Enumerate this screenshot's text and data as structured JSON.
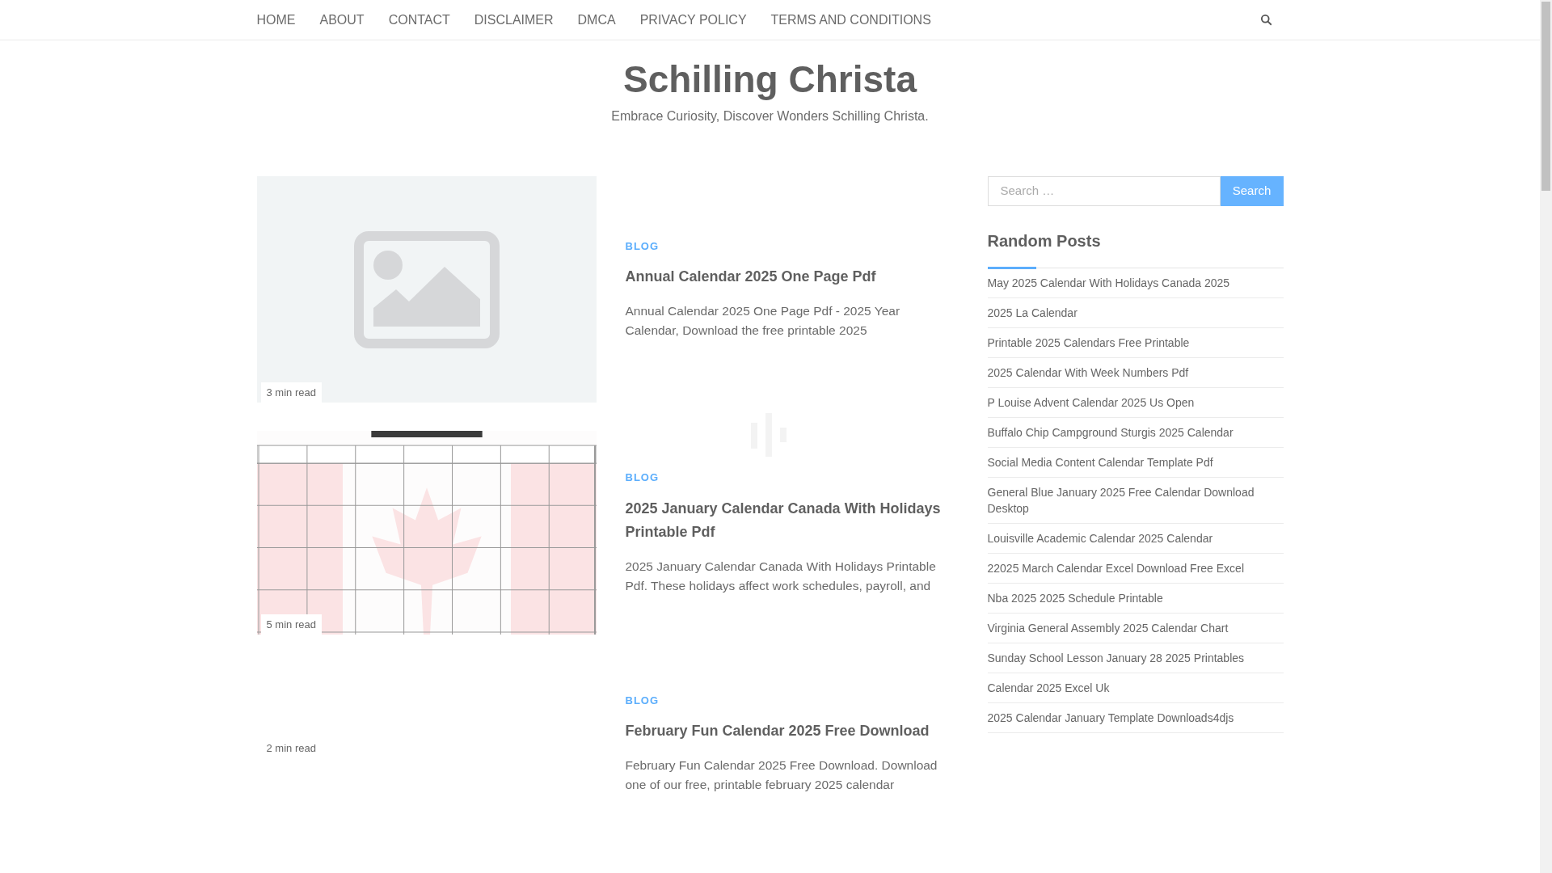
{
  "nav": {
    "items": [
      "HOME",
      "ABOUT",
      "CONTACT",
      "DISCLAIMER",
      "DMCA",
      "PRIVACY POLICY",
      "TERMS AND CONDITIONS"
    ]
  },
  "site": {
    "title": "Schilling Christa",
    "tagline": "Embrace Curiosity, Discover Wonders Schilling Christa."
  },
  "posts": [
    {
      "kind": "placeholder-image",
      "read_time": "3 min read",
      "category": "BLOG",
      "title": "Annual Calendar 2025 One Page Pdf",
      "excerpt": "Annual Calendar 2025 One Page Pdf - 2025 Year Calendar, Download the free printable 2025"
    },
    {
      "kind": "picture",
      "loading": true,
      "read_time": "5 min read",
      "category": "BLOG",
      "title": "2025 January Calendar Canada With Holidays Printable Pdf",
      "excerpt": "2025 January Calendar Canada With Holidays Printable Pdf. These holidays affect work schedules, payroll, and"
    },
    {
      "kind": "no-image",
      "read_time": "2 min read",
      "category": "BLOG",
      "title": "February Fun Calendar 2025 Free Download",
      "excerpt": "February Fun Calendar 2025 Free Download. Download one of our free, printable february 2025 calendar"
    }
  ],
  "sidebar": {
    "search": {
      "placeholder": "Search …",
      "button": "Search"
    },
    "random_posts": {
      "heading": "Random Posts",
      "items": [
        "May 2025 Calendar With Holidays Canada 2025",
        "2025 La Calendar",
        "Printable 2025 Calendars Free Printable",
        "2025 Calendar With Week Numbers Pdf",
        "P Louise Advent Calendar 2025 Us Open",
        "Buffalo Chip Campground Sturgis 2025 Calendar",
        "Social Media Content Calendar Template Pdf",
        "General Blue January 2025 Free Calendar Download Desktop",
        "Louisville Academic Calendar 2025 Calendar",
        "22025 March Calendar Excel Download Free Excel",
        "Nba 2025 2025 Schedule Printable",
        "Virginia General Assembly 2025 Calendar Chart",
        "Sunday School Lesson January 28 2025 Printables",
        "Calendar 2025 Excel Uk",
        "2025 Calendar January Template Downloads4djs"
      ]
    }
  }
}
